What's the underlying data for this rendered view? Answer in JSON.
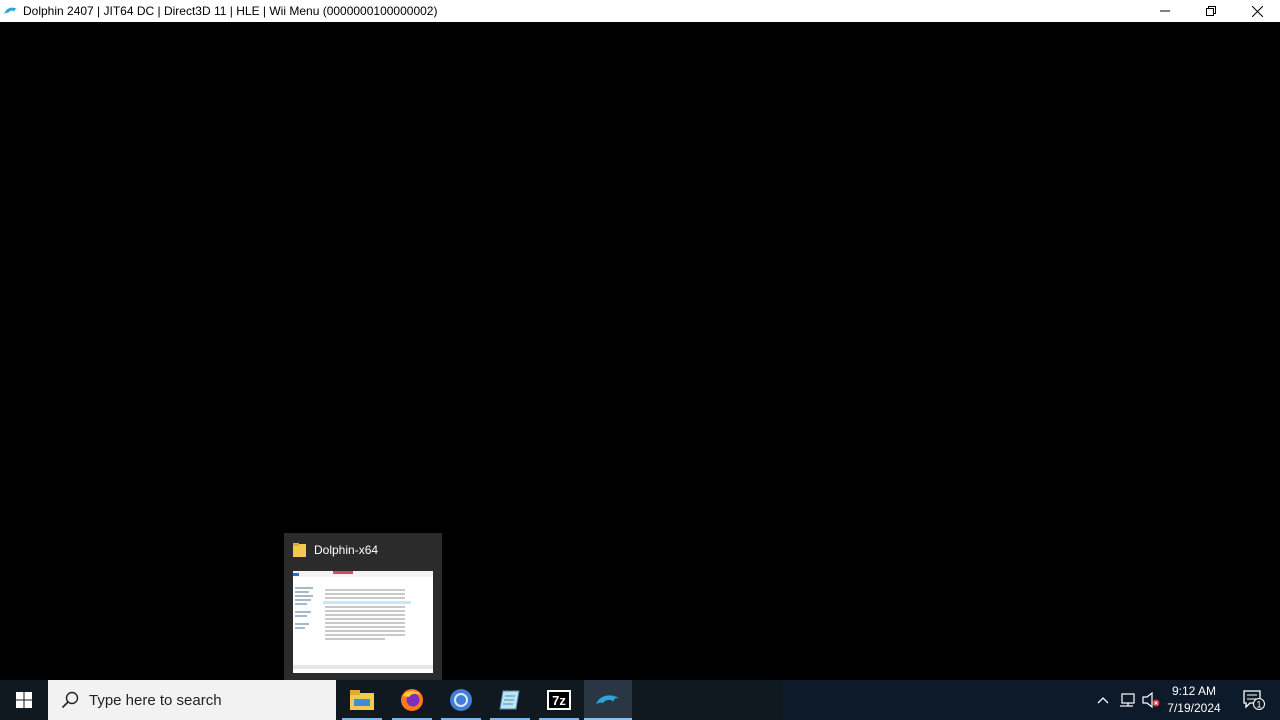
{
  "window": {
    "title": "Dolphin 2407 | JIT64 DC | Direct3D 11 | HLE | Wii Menu (0000000100000002)",
    "controls": [
      "minimize-icon",
      "restore-icon",
      "close-icon"
    ]
  },
  "thumbnail": {
    "title": "Dolphin-x64",
    "icon": "folder-icon"
  },
  "taskbar": {
    "search_placeholder": "Type here to search",
    "apps": [
      {
        "name": "File Explorer",
        "icon": "folder-icon"
      },
      {
        "name": "Firefox",
        "icon": "firefox-icon"
      },
      {
        "name": "Chrome",
        "icon": "chrome-icon"
      },
      {
        "name": "Notepad",
        "icon": "notepad-icon"
      },
      {
        "name": "7-Zip",
        "icon": "7zip-icon",
        "label": "7z"
      },
      {
        "name": "Dolphin",
        "icon": "dolphin-icon",
        "active": true
      }
    ],
    "clock": {
      "time": "9:12 AM",
      "date": "7/19/2024"
    },
    "notifications_count": "1"
  },
  "colors": {
    "accent": "#7fb6e8",
    "taskbar": "#101820",
    "titlebar": "#ffffff",
    "background": "#000000"
  }
}
